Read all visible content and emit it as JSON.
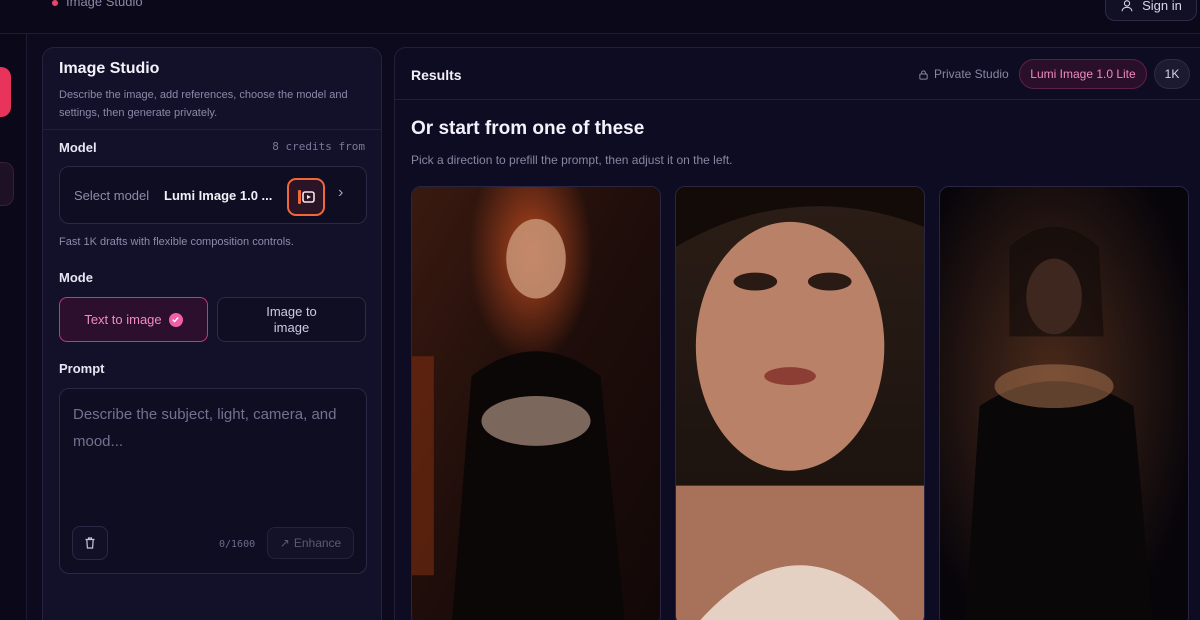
{
  "topbar": {
    "breadcrumb": "Image Studio",
    "signin_label": "Sign in"
  },
  "studio": {
    "title": "Image Studio",
    "description": "Describe the image, add references, choose the model and settings, then generate privately.",
    "model_label": "Model",
    "credits_text": "8 credits from",
    "select_model_label": "Select model",
    "selected_model_name": "Lumi Image 1.0 ...",
    "model_hint": "Fast 1K drafts with flexible composition controls.",
    "mode_label": "Mode",
    "modes": [
      "Text to image",
      "Image to image"
    ],
    "active_mode": "Text to image",
    "prompt_label": "Prompt",
    "prompt_placeholder": "Describe the subject, light, camera, and mood...",
    "prompt_value": "",
    "char_counter": "0/1600",
    "enhance_label": "Enhance"
  },
  "results": {
    "title": "Results",
    "privacy_label": "Private Studio",
    "model_pill": "Lumi Image 1.0 Lite",
    "resolution_pill": "1K",
    "heading": "Or start from one of these",
    "subheading": "Pick a direction to prefill the prompt, then adjust it on the left.",
    "presets": [
      {
        "name": "preset-card-1",
        "icon": "portrait-image"
      },
      {
        "name": "preset-card-2",
        "icon": "portrait-image"
      },
      {
        "name": "preset-card-3",
        "icon": "portrait-image"
      }
    ]
  },
  "colors": {
    "accent": "#e8345b",
    "pink": "#f05fa8",
    "bg": "#0c0a1c"
  }
}
